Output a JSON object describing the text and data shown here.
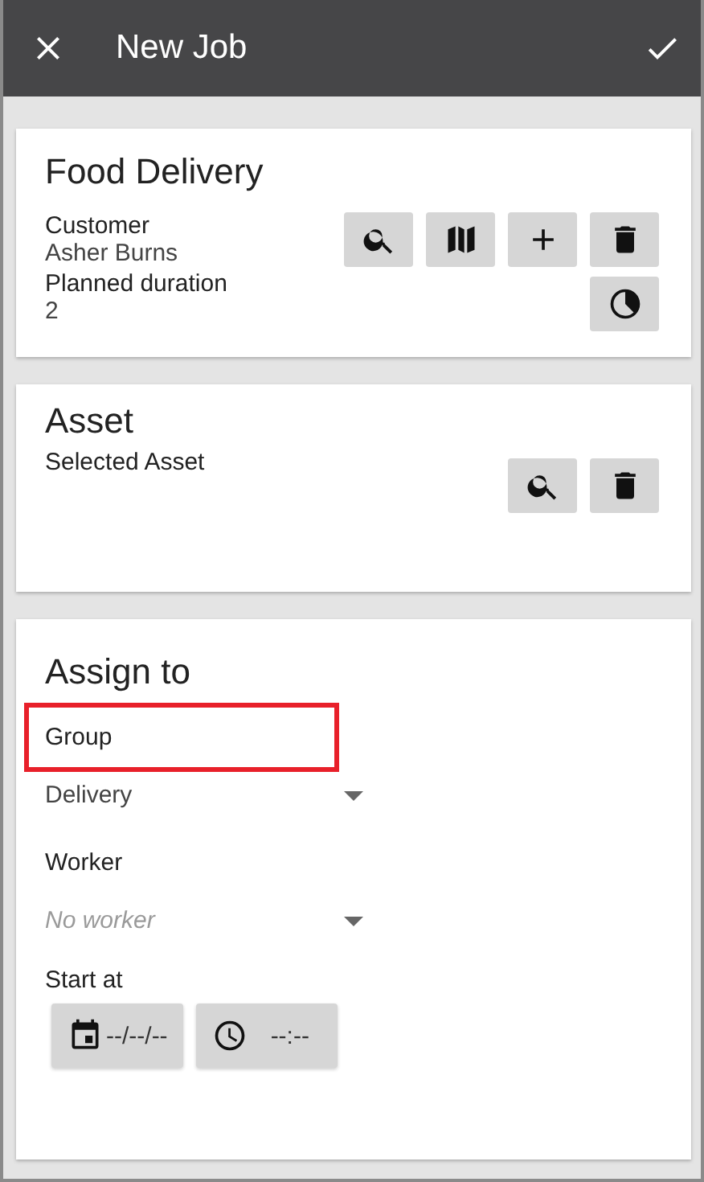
{
  "header": {
    "title": "New Job"
  },
  "job": {
    "title": "Food Delivery",
    "customer_label": "Customer",
    "customer": "Asher Burns",
    "duration_label": "Planned duration",
    "duration": "2"
  },
  "asset": {
    "title": "Asset",
    "label": "Selected Asset"
  },
  "assign": {
    "title": "Assign to",
    "group": {
      "label": "Group",
      "highlighted": true,
      "value": "Delivery"
    },
    "worker": {
      "label": "Worker",
      "highlighted": false,
      "placeholder": "No worker"
    },
    "start_label": "Start at",
    "date": "--/--/--",
    "time": "--:--"
  }
}
